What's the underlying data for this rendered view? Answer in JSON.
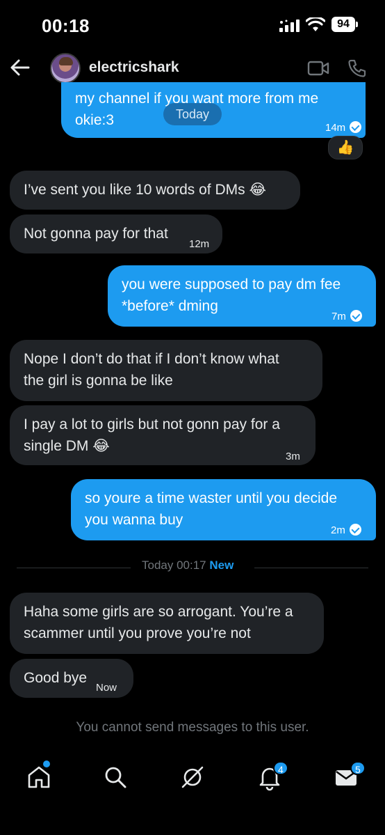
{
  "status_bar": {
    "time": "00:18",
    "battery": "94"
  },
  "header": {
    "username": "electricshark",
    "avatar_icon": "avatar-image",
    "video_icon": "video-camera-icon",
    "phone_icon": "phone-icon",
    "back_icon": "back-arrow-icon"
  },
  "messages": [
    {
      "dir": "out",
      "lines": [
        "my channel if you want more from me",
        "okie:3"
      ],
      "time": "14m",
      "read": true
    },
    {
      "dir": "in",
      "lines": [
        "I’ve sent you like 10 words of DMs 😂"
      ],
      "time": ""
    },
    {
      "dir": "in",
      "lines": [
        "Not gonna pay for that"
      ],
      "time": "12m"
    },
    {
      "dir": "out",
      "lines": [
        "you were supposed to pay dm fee",
        "*before* dming"
      ],
      "time": "7m",
      "read": true
    },
    {
      "dir": "in",
      "lines": [
        "Nope I don’t do that if I don’t know what",
        "the girl is gonna be like"
      ],
      "time": ""
    },
    {
      "dir": "in",
      "lines": [
        "I pay a lot to girls but not gonn pay for a",
        "single DM 😂"
      ],
      "time": "3m"
    },
    {
      "dir": "out",
      "lines": [
        "so youre a time waster until you decide",
        "you wanna buy"
      ],
      "time": "2m",
      "read": true
    },
    {
      "dir": "in",
      "lines": [
        "Haha some girls are so arrogant. You’re a",
        "scammer until you prove you’re not"
      ],
      "time": ""
    },
    {
      "dir": "in",
      "lines": [
        "Good bye"
      ],
      "time": "Now"
    }
  ],
  "today_pill": "Today",
  "reaction": "👍",
  "divider": {
    "label": "Today 00:17",
    "new_label": "New"
  },
  "notice": "You cannot send messages to this user.",
  "tabbar": {
    "notifications_badge": "4",
    "messages_badge": "5",
    "icons": [
      "home-icon",
      "search-icon",
      "grok-icon",
      "bell-icon",
      "mail-icon"
    ]
  },
  "colors": {
    "accent": "#1d9bf0",
    "incoming_bubble": "#202327",
    "background": "#000000",
    "muted_text": "#71767b"
  }
}
